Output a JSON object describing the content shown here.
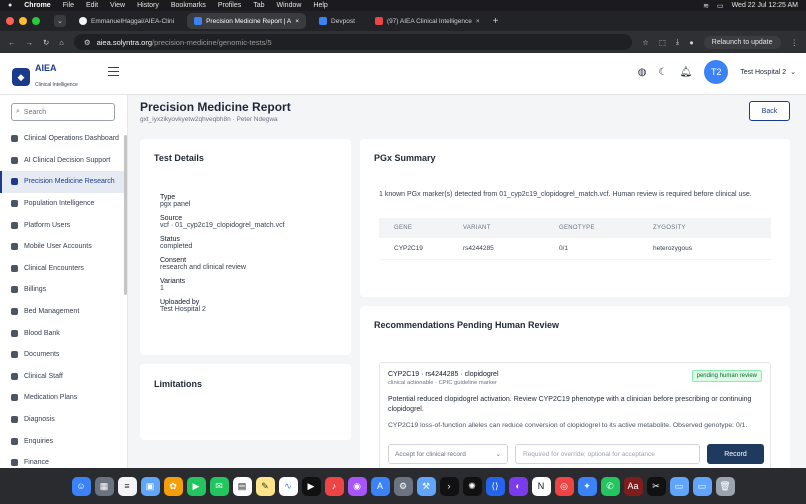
{
  "menubar": {
    "app": "Chrome",
    "items": [
      "File",
      "Edit",
      "View",
      "History",
      "Bookmarks",
      "Profiles",
      "Tab",
      "Window",
      "Help"
    ],
    "clock": "Wed 22 Jul  12:25 AM"
  },
  "tabs": [
    {
      "title": "EmmanuelHaggai/AIEA-Clini",
      "active": false,
      "color": "#f5f5f5"
    },
    {
      "title": "Precision Medicine Report | A",
      "active": true,
      "color": "#3b82f6"
    },
    {
      "title": "Devpost",
      "active": false,
      "color": "#3b82f6"
    },
    {
      "title": "(97) AIEA Clinical Intelligence",
      "active": false,
      "color": "#ef4444"
    }
  ],
  "address": {
    "host": "aiea.solyntra.org",
    "path": "/precision-medicine/genomic-tests/5",
    "relaunch": "Relaunch to update"
  },
  "brand": {
    "name": "AIEA",
    "tagline": "Clinical Intelligence"
  },
  "header": {
    "avatar": "T2",
    "hospital": "Test Hospital 2"
  },
  "sidebar": {
    "search_placeholder": "Search",
    "items": [
      {
        "label": "Clinical Operations Dashboard",
        "active": false
      },
      {
        "label": "AI Clinical Decision Support",
        "active": false
      },
      {
        "label": "Precision Medicine Research",
        "active": true
      },
      {
        "label": "Population Intelligence",
        "active": false
      },
      {
        "label": "Platform Users",
        "active": false
      },
      {
        "label": "Mobile User Accounts",
        "active": false
      },
      {
        "label": "Clinical Encounters",
        "active": false
      },
      {
        "label": "Billings",
        "active": false
      },
      {
        "label": "Bed Management",
        "active": false
      },
      {
        "label": "Blood Bank",
        "active": false
      },
      {
        "label": "Documents",
        "active": false
      },
      {
        "label": "Clinical Staff",
        "active": false
      },
      {
        "label": "Medication Plans",
        "active": false
      },
      {
        "label": "Diagnosis",
        "active": false
      },
      {
        "label": "Enquiries",
        "active": false
      },
      {
        "label": "Finance",
        "active": false
      }
    ]
  },
  "page": {
    "title": "Precision Medicine Report",
    "subtitle": "gxt_iyxzikyovkyetw2qhveqbh8n · Peter Ndegwa",
    "back": "Back"
  },
  "test_details": {
    "heading": "Test Details",
    "fields": [
      {
        "label": "Type",
        "value": "pgx panel"
      },
      {
        "label": "Source",
        "value": "vcf · 01_cyp2c19_clopidogrel_match.vcf"
      },
      {
        "label": "Status",
        "value": "completed"
      },
      {
        "label": "Consent",
        "value": "research and clinical review"
      },
      {
        "label": "Variants",
        "value": "1"
      },
      {
        "label": "Uploaded by",
        "value": "Test Hospital 2"
      }
    ]
  },
  "limitations": {
    "heading": "Limitations"
  },
  "pgx": {
    "heading": "PGx Summary",
    "summary": "1 known PGx marker(s) detected from 01_cyp2c19_clopidogrel_match.vcf. Human review is required before clinical use.",
    "columns": [
      "GENE",
      "VARIANT",
      "GENOTYPE",
      "ZYGOSITY"
    ],
    "rows": [
      [
        "CYP2C19",
        "rs4244285",
        "0/1",
        "heterozygous"
      ]
    ]
  },
  "recommendations": {
    "heading": "Recommendations Pending Human Review",
    "item": {
      "title": "CYP2C19 · rs4244285 · clopidogrel",
      "meta": "clinical actionable · CPIC guideline marker",
      "badge": "pending human review",
      "text": "Potential reduced clopidogrel activation. Review CYP2C19 phenotype with a clinician before prescribing or continuing clopidogrel.",
      "note": "CYP2C19 loss-of-function alleles can reduce conversion of clopidogrel to its active metabolite. Observed genotype: 0/1.",
      "select": "Accept for clinical record",
      "input_placeholder": "Required for override; optional for acceptance",
      "button": "Record"
    }
  },
  "colors": {
    "brand": "#1e3a8a",
    "accent": "#3b82f6",
    "badge": "#166534",
    "record_button": "#1e3a5f"
  }
}
